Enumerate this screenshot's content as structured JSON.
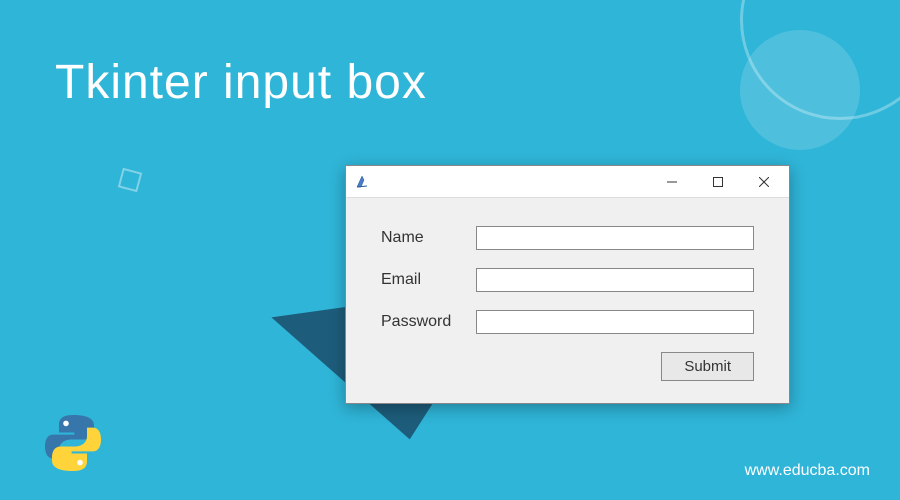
{
  "page": {
    "title": "Tkinter input box",
    "website": "www.educba.com"
  },
  "window": {
    "fields": [
      {
        "label": "Name",
        "value": ""
      },
      {
        "label": "Email",
        "value": ""
      },
      {
        "label": "Password",
        "value": ""
      }
    ],
    "submit_label": "Submit",
    "titlebar": {
      "minimize": "—",
      "maximize": "☐",
      "close": "✕"
    }
  },
  "icons": {
    "tkinter_feather": "feather-icon",
    "python": "python-logo"
  },
  "colors": {
    "background": "#2fb5d8",
    "window_bg": "#f0f0f0",
    "triangle": "#1a4d6b",
    "text_white": "#ffffff"
  }
}
